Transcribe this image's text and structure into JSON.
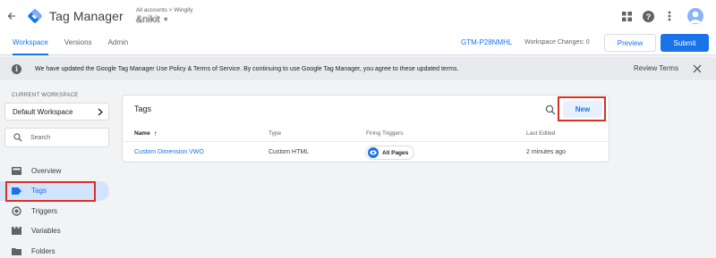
{
  "app": {
    "title": "Tag Manager",
    "breadcrumb": "All accounts > Wingify",
    "container_name": "&nikit"
  },
  "workspace_bar": {
    "tabs": [
      {
        "label": "Workspace",
        "active": true
      },
      {
        "label": "Versions",
        "active": false
      },
      {
        "label": "Admin",
        "active": false
      }
    ],
    "container_id": "GTM-P28NMHL",
    "changes": "Workspace Changes: 0",
    "preview_label": "Preview",
    "submit_label": "Submit"
  },
  "notice": {
    "message": "We have updated the Google Tag Manager Use Policy & Terms of Service. By continuing to use Google Tag Manager, you agree to these updated terms.",
    "action": "Review Terms"
  },
  "sidebar": {
    "current_workspace_label": "CURRENT WORKSPACE",
    "workspace_name": "Default Workspace",
    "search_placeholder": "Search",
    "items": [
      {
        "label": "Overview",
        "icon": "overview-icon",
        "active": false
      },
      {
        "label": "Tags",
        "icon": "tag-icon",
        "active": true
      },
      {
        "label": "Triggers",
        "icon": "trigger-icon",
        "active": false
      },
      {
        "label": "Variables",
        "icon": "variables-icon",
        "active": false
      },
      {
        "label": "Folders",
        "icon": "folder-icon",
        "active": false
      }
    ]
  },
  "tags_card": {
    "title": "Tags",
    "new_label": "New",
    "columns": [
      "Name",
      "Type",
      "Firing Triggers",
      "Last Edited"
    ],
    "sort_indicator": "↑",
    "rows": [
      {
        "name": "Custom Dimension VWO",
        "type": "Custom HTML",
        "trigger": "All Pages",
        "last_edited": "2 minutes ago"
      }
    ]
  },
  "colors": {
    "accent": "#1a73e8",
    "highlight": "#d93025",
    "active_nav": "#d2e3fc",
    "notice_bg": "#e8eaed"
  }
}
